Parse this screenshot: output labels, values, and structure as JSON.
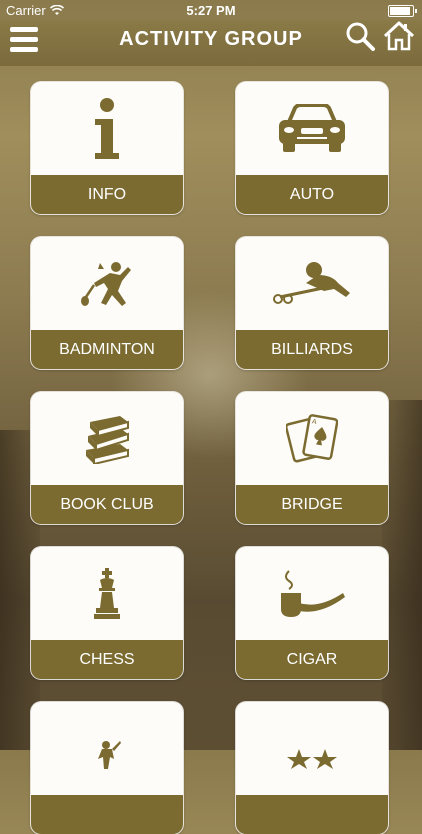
{
  "status_bar": {
    "carrier": "Carrier",
    "time": "5:27 PM"
  },
  "header": {
    "title": "ACTIVITY GROUP",
    "menu_icon": "hamburger-icon",
    "search_icon": "search-icon",
    "home_icon": "home-icon"
  },
  "tiles": [
    {
      "label": "INFO",
      "icon": "info-icon"
    },
    {
      "label": "AUTO",
      "icon": "car-icon"
    },
    {
      "label": "BADMINTON",
      "icon": "badminton-icon"
    },
    {
      "label": "BILLIARDS",
      "icon": "billiards-icon"
    },
    {
      "label": "BOOK CLUB",
      "icon": "books-icon"
    },
    {
      "label": "BRIDGE",
      "icon": "playing-cards-icon"
    },
    {
      "label": "CHESS",
      "icon": "chess-king-icon"
    },
    {
      "label": "CIGAR",
      "icon": "pipe-icon"
    },
    {
      "label": "",
      "icon": "statue-icon"
    },
    {
      "label": "",
      "icon": "stars-icon"
    }
  ],
  "colors": {
    "accent": "#7b6b30",
    "tile_bg": "#fdfcf8"
  }
}
